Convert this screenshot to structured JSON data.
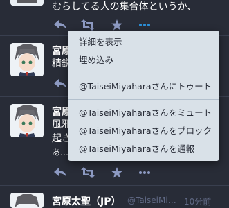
{
  "colors": {
    "background": "#282c37",
    "menu_background": "#d9e1e8",
    "icon": "#8d9ac2",
    "icon_active": "#2b90d9",
    "muted": "#606984"
  },
  "statuses": [
    {
      "content_lines": [
        "むらしてる人の集合体というか、"
      ],
      "actions": [
        "reply-icon",
        "boost-icon",
        "favourite-icon",
        "more-icon"
      ]
    },
    {
      "name": "宮原",
      "content_lines": [
        "精鋭"
      ],
      "actions": [
        "reply-icon"
      ]
    },
    {
      "name": "宮原",
      "content_lines": [
        "風邪",
        "起き",
        "あ…"
      ],
      "actions": [
        "reply-icon",
        "boost-icon",
        "favourite-icon",
        "more-icon"
      ]
    },
    {
      "name": "宮原太聖（JP）",
      "acct": "@TaiseiMi…",
      "time": "10分前"
    }
  ],
  "menu": {
    "items": [
      "詳細を表示",
      "埋め込み",
      "@TaiseiMiyaharaさんにトゥート",
      "@TaiseiMiyaharaさんをミュート",
      "@TaiseiMiyaharaさんをブロック",
      "@TaiseiMiyaharaさんを通報"
    ]
  }
}
